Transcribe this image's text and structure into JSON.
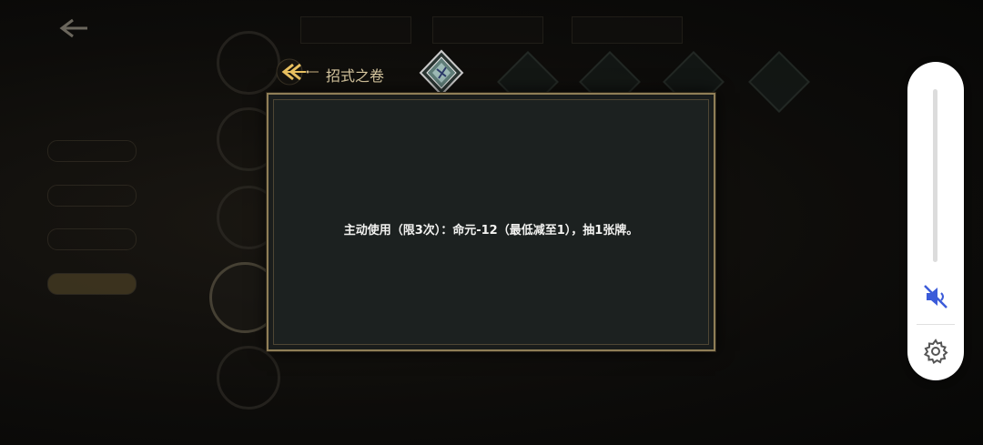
{
  "dialog": {
    "title": "招式之卷",
    "description": "主动使用（限3次）：命元-12（最低减至1），抽1张牌。"
  },
  "volume_panel": {
    "mute_state": "muted",
    "accent_color": "#3b5bd9"
  },
  "colors": {
    "panel_border": "#8f7e57",
    "panel_bg": "#1c2120",
    "title_gold": "#d8c8a0"
  }
}
